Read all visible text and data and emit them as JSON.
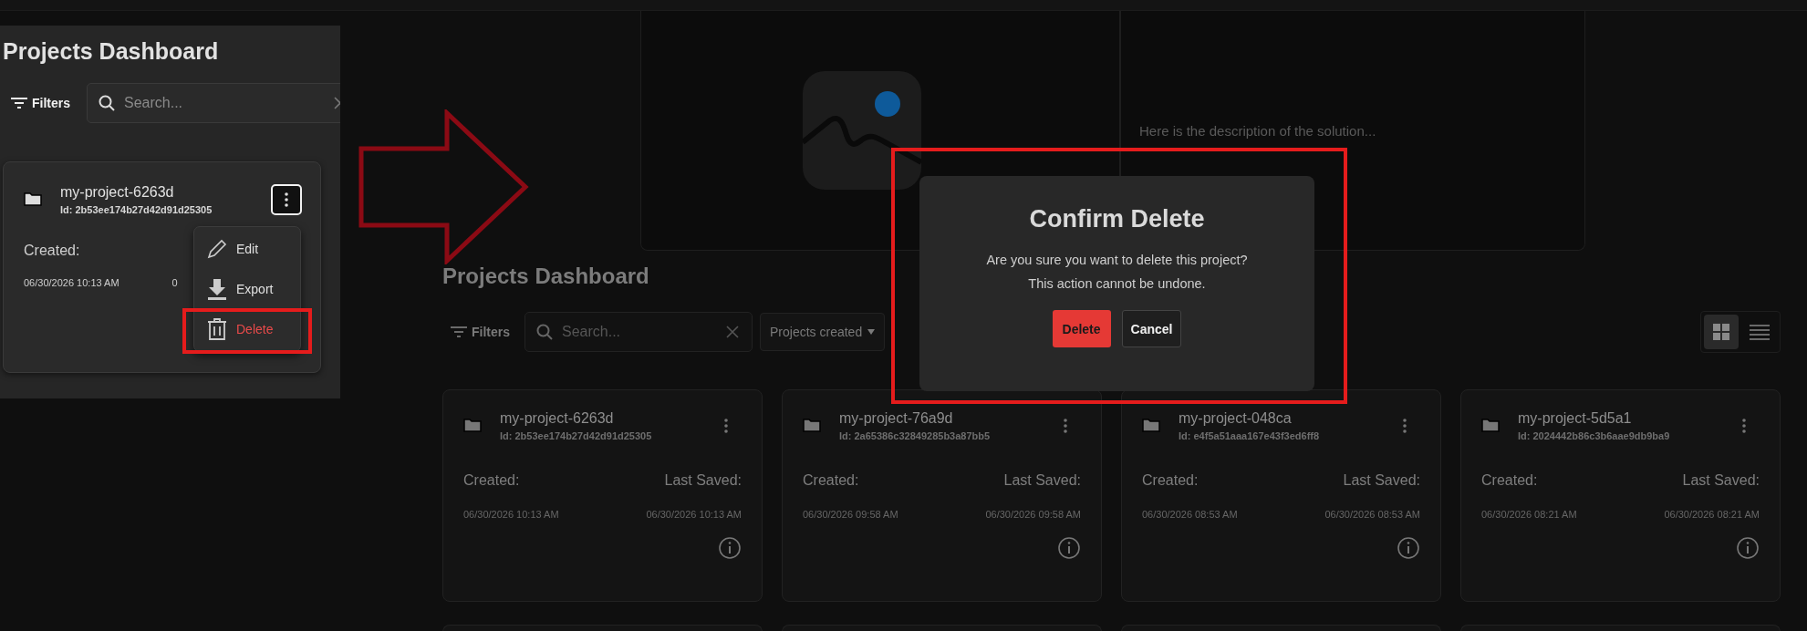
{
  "inset": {
    "title": "Projects Dashboard",
    "filters_label": "Filters",
    "search_placeholder": "Search...",
    "card": {
      "name": "my-project-6263d",
      "id": "Id: 2b53ee174b27d42d91d25305",
      "created_label": "Created:",
      "created": "06/30/2026 10:13 AM",
      "saved_partial": "0",
      "menu_open": true
    },
    "menu": [
      {
        "label": "Edit",
        "kind": "edit",
        "annotated": false
      },
      {
        "label": "Export",
        "kind": "export",
        "annotated": false
      },
      {
        "label": "Delete",
        "kind": "delete",
        "annotated": true
      }
    ]
  },
  "preview": {
    "description": "Here is the description of the solution..."
  },
  "dashboard": {
    "title": "Projects Dashboard",
    "filters_label": "Filters",
    "search_placeholder": "Search...",
    "sort_label": "Projects created",
    "views": [
      {
        "kind": "grid",
        "selected": true
      },
      {
        "kind": "list",
        "selected": false
      }
    ],
    "cards": [
      {
        "name": "my-project-6263d",
        "id": "Id: 2b53ee174b27d42d91d25305",
        "created_label": "Created:",
        "saved_label": "Last Saved:",
        "created": "06/30/2026 10:13 AM",
        "saved": "06/30/2026 10:13 AM"
      },
      {
        "name": "my-project-76a9d",
        "id": "Id: 2a65386c32849285b3a87bb5",
        "created_label": "Created:",
        "saved_label": "Last Saved:",
        "created": "06/30/2026 09:58 AM",
        "saved": "06/30/2026 09:58 AM"
      },
      {
        "name": "my-project-048ca",
        "id": "Id: e4f5a51aaa167e43f3ed6ff8",
        "created_label": "Created:",
        "saved_label": "Last Saved:",
        "created": "06/30/2026 08:53 AM",
        "saved": "06/30/2026 08:53 AM"
      },
      {
        "name": "my-project-5d5a1",
        "id": "Id: 2024442b86c3b6aae9db9ba9",
        "created_label": "Created:",
        "saved_label": "Last Saved:",
        "created": "06/30/2026 08:21 AM",
        "saved": "06/30/2026 08:21 AM"
      }
    ]
  },
  "dialog": {
    "title": "Confirm Delete",
    "message": [
      "Are you sure you want to delete this project?",
      "This action cannot be undone."
    ],
    "confirm": "Delete",
    "cancel": "Cancel",
    "annotated": true
  }
}
